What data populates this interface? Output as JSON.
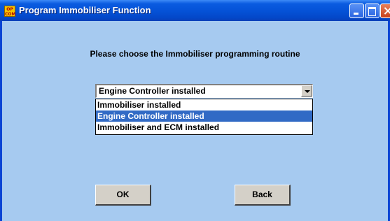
{
  "window": {
    "title": "Program Immobiliser Function",
    "icon_text": "OP\nCOM",
    "title_color": "#0553d8"
  },
  "dialog": {
    "prompt": "Please choose the Immobiliser programming routine",
    "background_color": "#a6caf0"
  },
  "combo": {
    "value": "Engine Controller installed",
    "options": [
      {
        "label": "Immobiliser installed",
        "selected": false
      },
      {
        "label": "Engine Controller installed",
        "selected": true
      },
      {
        "label": "Immobiliser and ECM installed",
        "selected": false
      }
    ],
    "highlight_color": "#316ac5"
  },
  "buttons": {
    "ok_label": "OK",
    "back_label": "Back"
  },
  "icons": {
    "app": "opcom-app-icon",
    "minimize": "minimize-icon",
    "maximize": "maximize-icon",
    "close": "close-icon",
    "dropdown": "chevron-down-icon"
  }
}
